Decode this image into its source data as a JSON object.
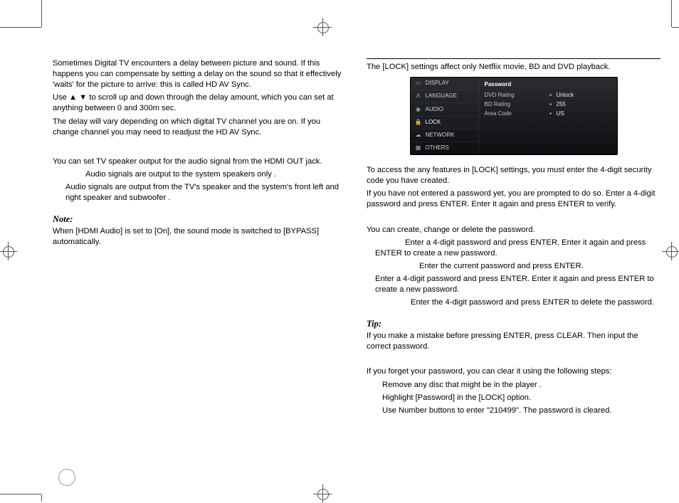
{
  "left": {
    "p1": "Sometimes Digital TV encounters a delay between picture and sound. If this happens you can compensate by setting a delay on the sound so that it effectively 'waits' for the picture to arrive: this is called HD  AV Sync.",
    "p2": "Use ▲ ▼ to scroll up and down through the delay amount, which you can set at anything between 0 and 300m sec.",
    "p3": "The delay will vary depending on which digital  TV channel you are on. If you change channel you may need to readjust the HD  AV Sync.",
    "p4": "You can set TV speaker output for the audio signal from the HDMI OUT  jack.",
    "p5": "Audio signals are output to the system speakers only .",
    "p6": "Audio signals are output from the  TV's speaker and the system's front left and right speaker and subwoofer .",
    "note_label": "Note:",
    "note_body": "When [HDMI Audio] is set to [On], the sound mode is switched to [BYPASS] automatically."
  },
  "right": {
    "intro": "The [LOCK] settings affect only Netflix movie, BD and DVD playback.",
    "screen": {
      "menu": [
        {
          "icon": "▭",
          "label": "DISPLAY"
        },
        {
          "icon": "A",
          "label": "LANGUAGE"
        },
        {
          "icon": "◉",
          "label": "AUDIO"
        },
        {
          "icon": "🔒",
          "label": "LOCK"
        },
        {
          "icon": "☁",
          "label": "NETWORK"
        },
        {
          "icon": "▦",
          "label": "OTHERS"
        }
      ],
      "header": "Password",
      "rows": [
        {
          "k": "DVD Rating",
          "v": "Unlock"
        },
        {
          "k": "BD Rating",
          "v": "255"
        },
        {
          "k": "Area Code",
          "v": "US"
        }
      ]
    },
    "access1": "To access the any features in [LOCK] settings, you must enter the 4-digit security code you have created.",
    "access2": "If you have not entered a password yet, you are prompted to do so. Enter a 4-digit password and press ENTER. Enter it again and press ENTER to verify.",
    "pw_head": "You can create, change or delete the password.",
    "pw_a": "Enter a 4-digit password and press ENTER. Enter it again and press ENTER to create a new password.",
    "pw_b": "Enter the current password and press ENTER.",
    "pw_b2": "Enter a 4-digit password and press ENTER. Enter it again and press ENTER to create a new password.",
    "pw_c": "Enter the 4-digit password and press ENTER to delete the password.",
    "tip_label": "Tip:",
    "tip_body": "If you make a mistake before pressing ENTER, press CLEAR.  Then input the correct password.",
    "forget": "If you forget your password, you can clear it using the following steps:",
    "step1": "Remove any disc that might be in the player .",
    "step2": "Highlight [Password] in the [LOCK] option.",
    "step3": "Use Number buttons to enter \"210499\".  The password is cleared."
  }
}
